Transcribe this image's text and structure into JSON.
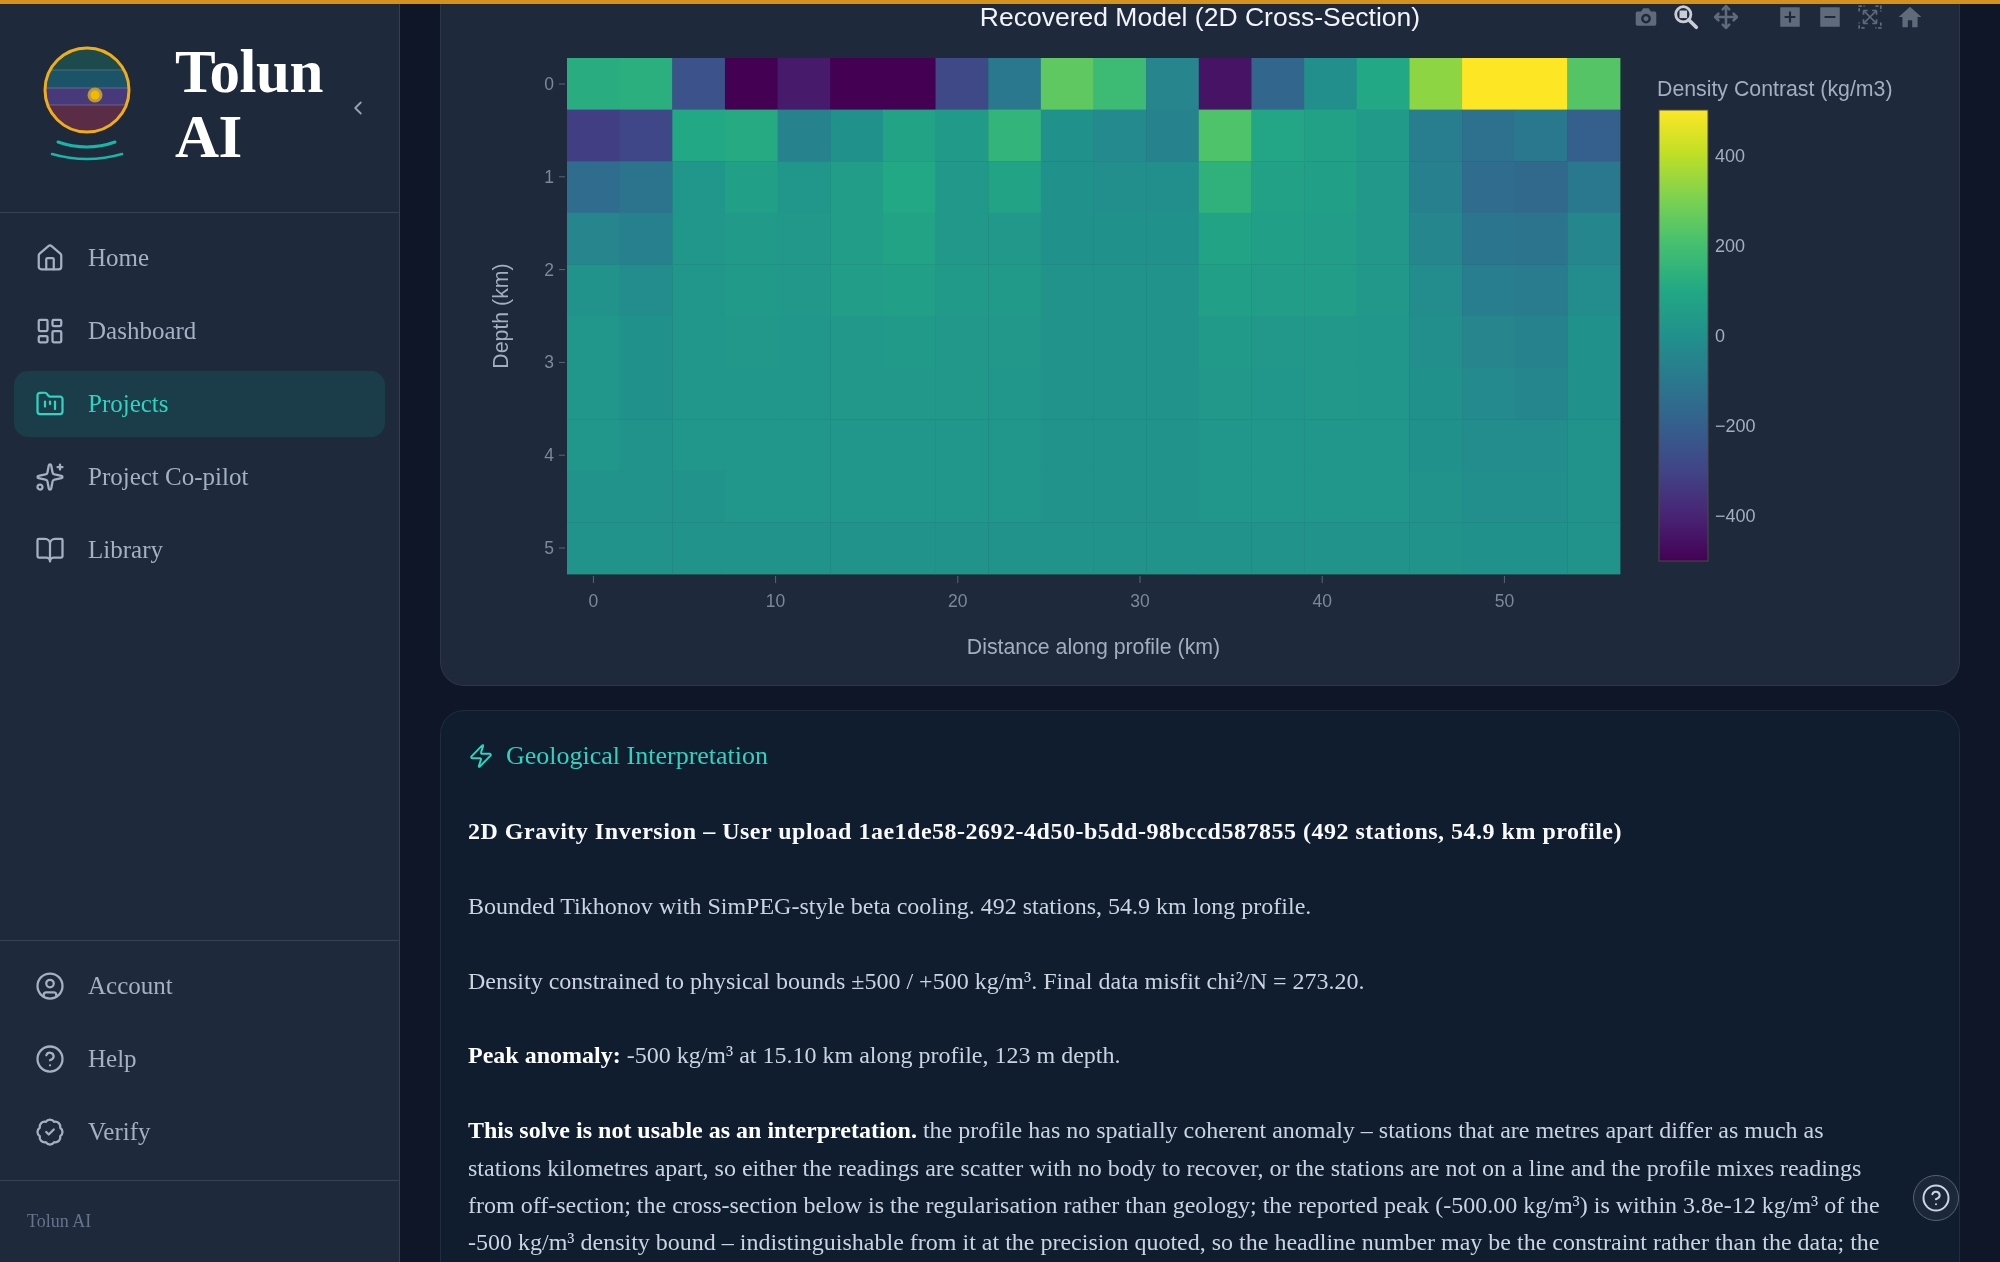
{
  "sidebar": {
    "brand": "Tolun AI",
    "nav": [
      {
        "label": "Home",
        "selected": false
      },
      {
        "label": "Dashboard",
        "selected": false
      },
      {
        "label": "Projects",
        "selected": true
      },
      {
        "label": "Project Co-pilot",
        "selected": false
      },
      {
        "label": "Library",
        "selected": false
      }
    ],
    "bottom_nav": [
      {
        "label": "Account",
        "selected": false
      },
      {
        "label": "Help",
        "selected": false
      },
      {
        "label": "Verify",
        "selected": false
      }
    ],
    "footer": "Tolun AI"
  },
  "chart": {
    "title": "Recovered Model (2D Cross-Section)",
    "toolbar": [
      {
        "selected": false
      },
      {
        "selected": true
      },
      {
        "selected": false
      },
      {
        "selected": false
      },
      {
        "selected": false
      },
      {
        "selected": false
      },
      {
        "selected": false
      }
    ],
    "heatmap": [
      {
        "cells": [
          {
            "color": "#29ad80"
          },
          {
            "color": "#2caf7e"
          },
          {
            "color": "#3b528a"
          },
          {
            "color": "#440154"
          },
          {
            "color": "#471a6b"
          },
          {
            "color": "#440154"
          },
          {
            "color": "#440154"
          },
          {
            "color": "#3f4988"
          },
          {
            "color": "#2a788e"
          },
          {
            "color": "#5fc861"
          },
          {
            "color": "#3dba74"
          },
          {
            "color": "#26858d"
          },
          {
            "color": "#461365"
          },
          {
            "color": "#32668d"
          },
          {
            "color": "#228f8c"
          },
          {
            "color": "#22a884"
          },
          {
            "color": "#8ed544"
          },
          {
            "color": "#fde725"
          },
          {
            "color": "#fde725"
          },
          {
            "color": "#54c467"
          }
        ]
      },
      {
        "cells": [
          {
            "color": "#423e83"
          },
          {
            "color": "#404788"
          },
          {
            "color": "#22a884"
          },
          {
            "color": "#25aa82"
          },
          {
            "color": "#26828d"
          },
          {
            "color": "#21918c"
          },
          {
            "color": "#22a386"
          },
          {
            "color": "#219a89"
          },
          {
            "color": "#33b47a"
          },
          {
            "color": "#21918c"
          },
          {
            "color": "#248a8d"
          },
          {
            "color": "#26828d"
          },
          {
            "color": "#4fc36a"
          },
          {
            "color": "#22a685"
          },
          {
            "color": "#22a186"
          },
          {
            "color": "#219a89"
          },
          {
            "color": "#287d8e"
          },
          {
            "color": "#2d718e"
          },
          {
            "color": "#2a788e"
          },
          {
            "color": "#355f8d"
          }
        ]
      },
      {
        "cells": [
          {
            "color": "#306c8e"
          },
          {
            "color": "#2c738e"
          },
          {
            "color": "#21968a"
          },
          {
            "color": "#229f87"
          },
          {
            "color": "#21968a"
          },
          {
            "color": "#229d88"
          },
          {
            "color": "#22a884"
          },
          {
            "color": "#21988a"
          },
          {
            "color": "#22a386"
          },
          {
            "color": "#21918c"
          },
          {
            "color": "#228f8c"
          },
          {
            "color": "#228f8c"
          },
          {
            "color": "#30b17c"
          },
          {
            "color": "#22a186"
          },
          {
            "color": "#229f87"
          },
          {
            "color": "#21988a"
          },
          {
            "color": "#27808d"
          },
          {
            "color": "#306c8e"
          },
          {
            "color": "#31698d"
          },
          {
            "color": "#2a788e"
          }
        ]
      },
      {
        "cells": [
          {
            "color": "#26858d"
          },
          {
            "color": "#27808d"
          },
          {
            "color": "#21968a"
          },
          {
            "color": "#219a89"
          },
          {
            "color": "#21988a"
          },
          {
            "color": "#229d88"
          },
          {
            "color": "#22a386"
          },
          {
            "color": "#21988a"
          },
          {
            "color": "#21988a"
          },
          {
            "color": "#21918c"
          },
          {
            "color": "#21918c"
          },
          {
            "color": "#21918c"
          },
          {
            "color": "#22a386"
          },
          {
            "color": "#229f87"
          },
          {
            "color": "#229d88"
          },
          {
            "color": "#21988a"
          },
          {
            "color": "#25878d"
          },
          {
            "color": "#2b768e"
          },
          {
            "color": "#2c738e"
          },
          {
            "color": "#25878d"
          }
        ]
      },
      {
        "cells": [
          {
            "color": "#21938b"
          },
          {
            "color": "#238c8c"
          },
          {
            "color": "#21968a"
          },
          {
            "color": "#219a89"
          },
          {
            "color": "#21988a"
          },
          {
            "color": "#229d88"
          },
          {
            "color": "#229f87"
          },
          {
            "color": "#219a89"
          },
          {
            "color": "#219a89"
          },
          {
            "color": "#21938b"
          },
          {
            "color": "#21938b"
          },
          {
            "color": "#21938b"
          },
          {
            "color": "#229f87"
          },
          {
            "color": "#229d88"
          },
          {
            "color": "#229d88"
          },
          {
            "color": "#21988a"
          },
          {
            "color": "#238c8c"
          },
          {
            "color": "#287d8e"
          },
          {
            "color": "#297b8e"
          },
          {
            "color": "#238c8c"
          }
        ]
      },
      {
        "cells": [
          {
            "color": "#21968a"
          },
          {
            "color": "#21918c"
          },
          {
            "color": "#21968a"
          },
          {
            "color": "#21988a"
          },
          {
            "color": "#21968a"
          },
          {
            "color": "#21988a"
          },
          {
            "color": "#219a89"
          },
          {
            "color": "#21988a"
          },
          {
            "color": "#21988a"
          },
          {
            "color": "#21938b"
          },
          {
            "color": "#21938b"
          },
          {
            "color": "#21938b"
          },
          {
            "color": "#219a89"
          },
          {
            "color": "#21988a"
          },
          {
            "color": "#21988a"
          },
          {
            "color": "#21968a"
          },
          {
            "color": "#228f8c"
          },
          {
            "color": "#26858d"
          },
          {
            "color": "#26828d"
          },
          {
            "color": "#21918c"
          }
        ]
      },
      {
        "cells": [
          {
            "color": "#21968a"
          },
          {
            "color": "#21918c"
          },
          {
            "color": "#21968a"
          },
          {
            "color": "#21968a"
          },
          {
            "color": "#21968a"
          },
          {
            "color": "#21988a"
          },
          {
            "color": "#21988a"
          },
          {
            "color": "#21988a"
          },
          {
            "color": "#21968a"
          },
          {
            "color": "#21938b"
          },
          {
            "color": "#21938b"
          },
          {
            "color": "#21938b"
          },
          {
            "color": "#21988a"
          },
          {
            "color": "#21968a"
          },
          {
            "color": "#21988a"
          },
          {
            "color": "#21968a"
          },
          {
            "color": "#21918c"
          },
          {
            "color": "#248a8d"
          },
          {
            "color": "#25878d"
          },
          {
            "color": "#21918c"
          }
        ]
      },
      {
        "cells": [
          {
            "color": "#21968a"
          },
          {
            "color": "#21938b"
          },
          {
            "color": "#21968a"
          },
          {
            "color": "#21968a"
          },
          {
            "color": "#21968a"
          },
          {
            "color": "#21968a"
          },
          {
            "color": "#21968a"
          },
          {
            "color": "#21968a"
          },
          {
            "color": "#21968a"
          },
          {
            "color": "#21938b"
          },
          {
            "color": "#21938b"
          },
          {
            "color": "#21938b"
          },
          {
            "color": "#21968a"
          },
          {
            "color": "#21968a"
          },
          {
            "color": "#21968a"
          },
          {
            "color": "#21968a"
          },
          {
            "color": "#21918c"
          },
          {
            "color": "#238c8c"
          },
          {
            "color": "#238c8c"
          },
          {
            "color": "#21938b"
          }
        ]
      },
      {
        "cells": [
          {
            "color": "#21938b"
          },
          {
            "color": "#21938b"
          },
          {
            "color": "#21938b"
          },
          {
            "color": "#21968a"
          },
          {
            "color": "#21968a"
          },
          {
            "color": "#21968a"
          },
          {
            "color": "#21968a"
          },
          {
            "color": "#21968a"
          },
          {
            "color": "#21968a"
          },
          {
            "color": "#21938b"
          },
          {
            "color": "#21938b"
          },
          {
            "color": "#21938b"
          },
          {
            "color": "#21968a"
          },
          {
            "color": "#21968a"
          },
          {
            "color": "#21968a"
          },
          {
            "color": "#21968a"
          },
          {
            "color": "#21938b"
          },
          {
            "color": "#228f8c"
          },
          {
            "color": "#228f8c"
          },
          {
            "color": "#21938b"
          }
        ]
      },
      {
        "cells": [
          {
            "color": "#21938b"
          },
          {
            "color": "#21938b"
          },
          {
            "color": "#21938b"
          },
          {
            "color": "#21938b"
          },
          {
            "color": "#21938b"
          },
          {
            "color": "#21938b"
          },
          {
            "color": "#21938b"
          },
          {
            "color": "#21938b"
          },
          {
            "color": "#21938b"
          },
          {
            "color": "#21938b"
          },
          {
            "color": "#21938b"
          },
          {
            "color": "#21938b"
          },
          {
            "color": "#21938b"
          },
          {
            "color": "#21938b"
          },
          {
            "color": "#21938b"
          },
          {
            "color": "#21938b"
          },
          {
            "color": "#21938b"
          },
          {
            "color": "#21918c"
          },
          {
            "color": "#21918c"
          },
          {
            "color": "#21938b"
          }
        ]
      }
    ],
    "y_axis": {
      "title": "Depth (km)",
      "ticks": [
        "0",
        "1",
        "2",
        "3",
        "4",
        "5"
      ]
    },
    "x_axis": {
      "title": "Distance along profile (km)",
      "ticks": [
        "0",
        "10",
        "20",
        "30",
        "40",
        "50"
      ]
    },
    "colorbar": {
      "title": "Density Contrast (kg/m3)",
      "ticks": [
        "400",
        "200",
        "0",
        "−200",
        "−400"
      ]
    }
  },
  "interpretation": {
    "title": "Geological Interpretation",
    "heading": "2D Gravity Inversion – User upload 1ae1de58-2692-4d50-b5dd-98bccd587855 (492 stations, 54.9 km profile)",
    "paragraphs": [
      "Bounded Tikhonov with SimPEG-style beta cooling. 492 stations, 54.9 km long profile.",
      "Density constrained to physical bounds ±500 / +500 kg/m³. Final data misfit chi²/N = 273.20.",
      "**Peak anomaly:** -500 kg/m³ at 15.10 km along profile, 123 m depth.",
      "**This solve is not usable as an interpretation.** the profile has no spatially coherent anomaly – stations that are metres apart differ as much as stations kilometres apart, so either the readings are scatter with no body to recover, or the stations are not on a line and the profile mixes readings from off-section; the cross-section below is the regularisation rather than geology; the reported peak (-500.00 kg/m³) is within 3.8e-12 kg/m³ of the -500 kg/m³ density bound – indistinguishable from it at the precision quoted, so the headline number may be the constraint rather than the data; the"
    ]
  }
}
